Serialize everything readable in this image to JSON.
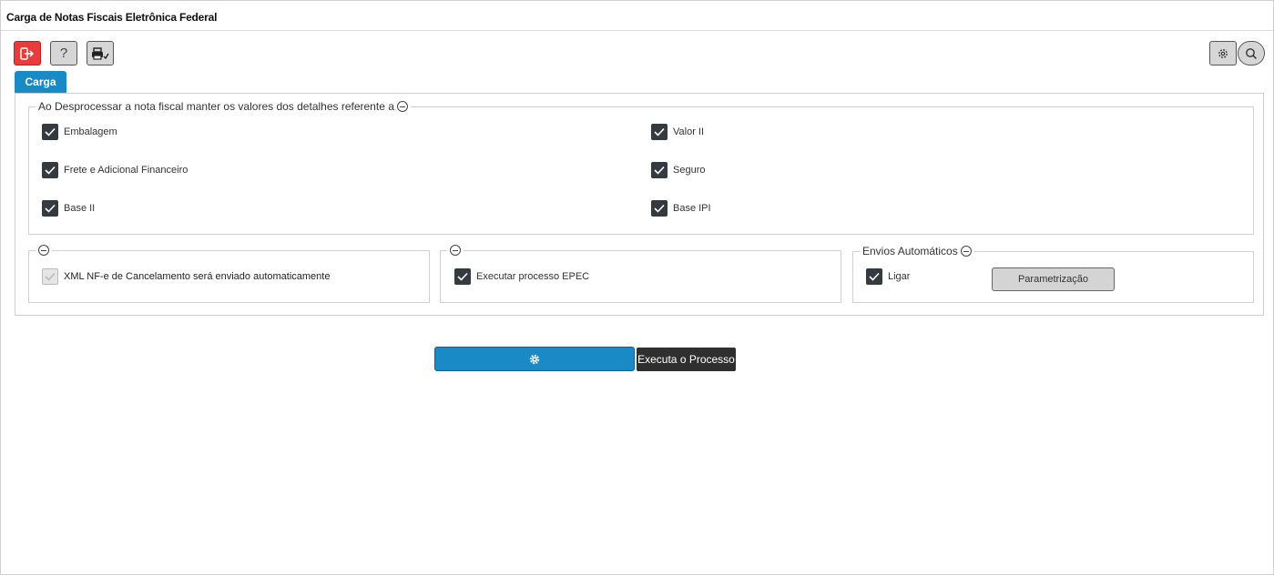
{
  "window": {
    "title": "Carga de Notas Fiscais Eletrônica Federal"
  },
  "toolbar": {
    "buttons": [
      {
        "name": "exit",
        "icon": "exit-icon"
      },
      {
        "name": "help",
        "icon": "question-icon",
        "label": "?"
      },
      {
        "name": "print",
        "icon": "printer-icon"
      },
      {
        "name": "settings",
        "icon": "gear-icon"
      },
      {
        "name": "search",
        "icon": "search-icon"
      }
    ]
  },
  "tabs": [
    {
      "label": "Carga",
      "active": true
    }
  ],
  "detail_group": {
    "legend": "Ao Desprocessar a nota fiscal manter os valores dos detalhes referente a",
    "items": [
      {
        "label": "Embalagem",
        "checked": true
      },
      {
        "label": "Frete e Adicional Financeiro",
        "checked": true
      },
      {
        "label": "Base II",
        "checked": true
      },
      {
        "label": "Valor II",
        "checked": true
      },
      {
        "label": "Seguro",
        "checked": true
      },
      {
        "label": "Base IPI",
        "checked": true
      }
    ]
  },
  "cancel_group": {
    "legend": "",
    "item": {
      "label": "XML NF-e de Cancelamento será enviado automaticamente",
      "checked": true,
      "disabled": true
    }
  },
  "epec_group": {
    "legend": "",
    "item": {
      "label": "Executar processo EPEC",
      "checked": true
    }
  },
  "auto_group": {
    "legend": "Envios Automáticos",
    "item": {
      "label": "Ligar",
      "checked": true
    },
    "button_label": "Parametrização"
  },
  "run": {
    "icon": "gear-icon",
    "tooltip": "Executa o Processo"
  },
  "colors": {
    "accent": "#1a8ac6",
    "danger": "#e83b3b",
    "checkbox": "#343a40"
  }
}
